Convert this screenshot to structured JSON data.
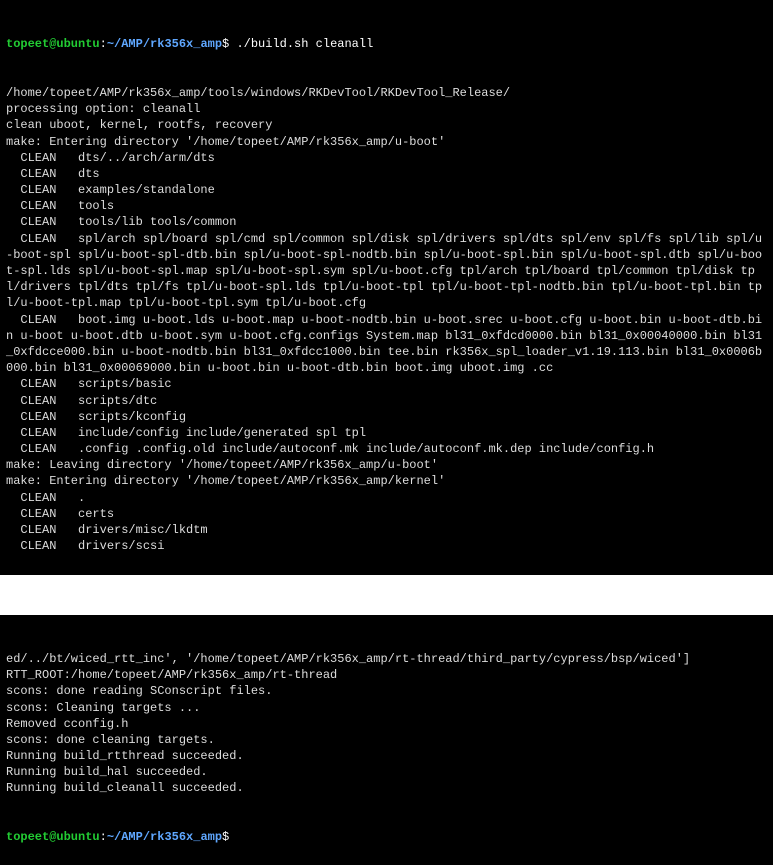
{
  "prompt": {
    "user_host": "topeet@ubuntu",
    "colon": ":",
    "path": "~/AMP/rk356x_amp",
    "dollar": "$"
  },
  "command1": " ./build.sh cleanall",
  "block1": {
    "lines": [
      "/home/topeet/AMP/rk356x_amp/tools/windows/RKDevTool/RKDevTool_Release/",
      "processing option: cleanall",
      "clean uboot, kernel, rootfs, recovery",
      "make: Entering directory '/home/topeet/AMP/rk356x_amp/u-boot'",
      "  CLEAN   dts/../arch/arm/dts",
      "  CLEAN   dts",
      "  CLEAN   examples/standalone",
      "  CLEAN   tools",
      "  CLEAN   tools/lib tools/common",
      "  CLEAN   spl/arch spl/board spl/cmd spl/common spl/disk spl/drivers spl/dts spl/env spl/fs spl/lib spl/u-boot-spl spl/u-boot-spl-dtb.bin spl/u-boot-spl-nodtb.bin spl/u-boot-spl.bin spl/u-boot-spl.dtb spl/u-boot-spl.lds spl/u-boot-spl.map spl/u-boot-spl.sym spl/u-boot.cfg tpl/arch tpl/board tpl/common tpl/disk tpl/drivers tpl/dts tpl/fs tpl/u-boot-spl.lds tpl/u-boot-tpl tpl/u-boot-tpl-nodtb.bin tpl/u-boot-tpl.bin tpl/u-boot-tpl.map tpl/u-boot-tpl.sym tpl/u-boot.cfg",
      "  CLEAN   boot.img u-boot.lds u-boot.map u-boot-nodtb.bin u-boot.srec u-boot.cfg u-boot.bin u-boot-dtb.bin u-boot u-boot.dtb u-boot.sym u-boot.cfg.configs System.map bl31_0xfdcd0000.bin bl31_0x00040000.bin bl31_0xfdcce000.bin u-boot-nodtb.bin bl31_0xfdcc1000.bin tee.bin rk356x_spl_loader_v1.19.113.bin bl31_0x0006b000.bin bl31_0x00069000.bin u-boot.bin u-boot-dtb.bin boot.img uboot.img .cc",
      "  CLEAN   scripts/basic",
      "  CLEAN   scripts/dtc",
      "  CLEAN   scripts/kconfig",
      "  CLEAN   include/config include/generated spl tpl",
      "  CLEAN   .config .config.old include/autoconf.mk include/autoconf.mk.dep include/config.h",
      "make: Leaving directory '/home/topeet/AMP/rk356x_amp/u-boot'",
      "make: Entering directory '/home/topeet/AMP/rk356x_amp/kernel'",
      "  CLEAN   .",
      "  CLEAN   certs",
      "  CLEAN   drivers/misc/lkdtm",
      "  CLEAN   drivers/scsi"
    ]
  },
  "block2": {
    "lines": [
      "ed/../bt/wiced_rtt_inc', '/home/topeet/AMP/rk356x_amp/rt-thread/third_party/cypress/bsp/wiced']",
      "RTT_ROOT:/home/topeet/AMP/rk356x_amp/rt-thread",
      "scons: done reading SConscript files.",
      "scons: Cleaning targets ...",
      "Removed cconfig.h",
      "scons: done cleaning targets.",
      "Running build_rtthread succeeded.",
      "Running build_hal succeeded.",
      "Running build_cleanall succeeded."
    ]
  },
  "command2": " "
}
